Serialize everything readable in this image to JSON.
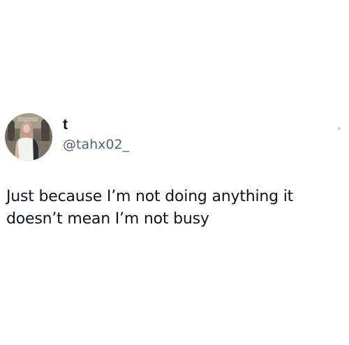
{
  "tweet": {
    "display_name": "t",
    "handle": "@tahx02_",
    "text": "Just because I’m not doing anything it\ndoesn’t mean I’m not busy",
    "avatar_icon": "user-avatar-photo",
    "more_icon": "more-options-icon"
  },
  "colors": {
    "background": "#ffffff",
    "text_primary": "#0f1419",
    "text_secondary": "#536471"
  }
}
